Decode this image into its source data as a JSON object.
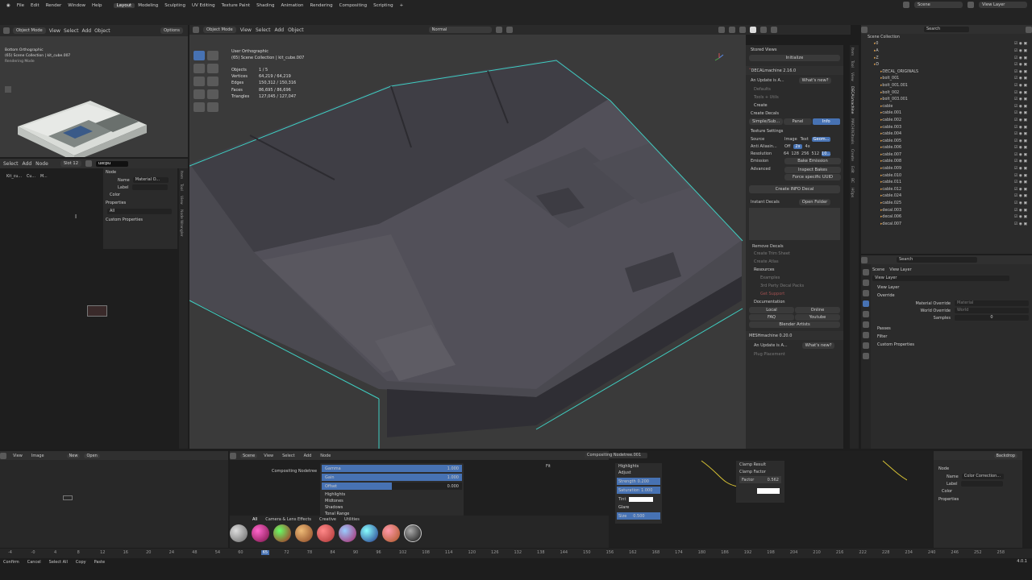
{
  "menu": {
    "items": [
      "File",
      "Edit",
      "Render",
      "Window",
      "Help"
    ],
    "workspaces": [
      "Layout",
      "Modeling",
      "Sculpting",
      "UV Editing",
      "Texture Paint",
      "Shading",
      "Animation",
      "Rendering",
      "Compositing",
      "Scripting"
    ],
    "active_workspace": "Layout",
    "scene": "Scene",
    "view_layer": "View Layer"
  },
  "left_tool_header": {
    "mode": "Object Mode",
    "items": [
      "View",
      "Select",
      "Add",
      "Object"
    ],
    "options": "Options"
  },
  "viewport_header": {
    "mode": "Object Mode",
    "items": [
      "View",
      "Select",
      "Add",
      "Object"
    ],
    "transform": "Normal",
    "options": "Options"
  },
  "mini_view": {
    "title": "Bottom Orthographic",
    "collection": "(65) Scene Collection | kit_cube.007",
    "label": "Rendering Mode"
  },
  "viewport": {
    "view_name": "User Orthographic",
    "collection": "(65) Scene Collection | kit_cube.007",
    "stats": [
      {
        "label": "Objects",
        "value": "1 / 5"
      },
      {
        "label": "Vertices",
        "value": "64,219 / 64,219"
      },
      {
        "label": "Edges",
        "value": "150,312 / 150,316"
      },
      {
        "label": "Faces",
        "value": "86,695 / 86,696"
      },
      {
        "label": "Triangles",
        "value": "127,045 / 127,047"
      }
    ]
  },
  "node_header": {
    "items": [
      "Select",
      "Add",
      "Node"
    ],
    "slot": "Slot 12",
    "material": "uxcpu"
  },
  "node_sidebar": {
    "node_label": "Node",
    "name_label": "Name",
    "name_value": "Material O...",
    "label_label": "Label",
    "color_label": "Color",
    "properties_label": "Properties",
    "all_label": "All",
    "custom_props": "Custom Properties"
  },
  "node_breadcrumb": [
    "Kit_cu...",
    "Cu...",
    "M..."
  ],
  "decal_panel": {
    "stored_views": "Stored Views",
    "initialize": "Initialize",
    "title": "DECALmachine 2.16.0",
    "update": "An Update is A...",
    "whats_new": "What's new?",
    "defaults": "Defaults",
    "tools": "Tools + Utils",
    "create": "Create",
    "create_decals": "Create Decals",
    "tabs": [
      "Simple/Sub...",
      "Panel",
      "Info"
    ],
    "active_tab": "Info",
    "texture_settings": "Texture Settings",
    "source_label": "Source",
    "source_options": [
      "Image",
      "Text",
      "Geom..."
    ],
    "anti_alias_label": "Anti Aliasin...",
    "anti_alias_options": [
      "Off",
      "2x",
      "4x"
    ],
    "resolution_label": "Resolution",
    "resolution_options": [
      "64",
      "128",
      "256",
      "512",
      "10..."
    ],
    "emission_label": "Emission",
    "bake_emission": "Bake Emission",
    "advanced_label": "Advanced",
    "inspect_bakes": "Inspect Bakes",
    "force_uuid": "Force specific UUID",
    "create_info": "Create INFO Decal",
    "instant_decals": "Instant Decals",
    "open_folder": "Open Folder",
    "remove_decals": "Remove Decals",
    "create_trim": "Create Trim Sheet",
    "create_atlas": "Create Atlas",
    "resources": "Resources",
    "examples": "Examples",
    "third_party": "3rd Party Decal Packs",
    "get_support": "Get Support",
    "documentation": "Documentation",
    "doc_buttons": [
      "Local",
      "Online",
      "FAQ",
      "Youtube"
    ],
    "blender_artists": "Blender Artists",
    "mesh_title": "MESHmachine 0.20.0",
    "mesh_update": "An Update is A...",
    "mesh_whats_new": "What's new?",
    "plug_placement": "Plug Placement"
  },
  "side_tabs": [
    "Item",
    "Tool",
    "View",
    "DECALmachine",
    "MACHIN3tools",
    "Create",
    "Edit",
    "BC",
    "HOps",
    "Kit Ops",
    "Node Wrangler",
    "Quick Tools",
    "Animation",
    "Grease Pencil"
  ],
  "outliner": {
    "title": "Scene Collection",
    "search_placeholder": "Search",
    "rows": [
      {
        "name": "0",
        "indent": 1
      },
      {
        "name": "A",
        "indent": 1
      },
      {
        "name": "Z",
        "indent": 1
      },
      {
        "name": "D",
        "indent": 1
      },
      {
        "name": "DECAL_ORIGINALS",
        "indent": 2
      },
      {
        "name": "bolt_001",
        "indent": 2
      },
      {
        "name": "bolt_001.001",
        "indent": 2
      },
      {
        "name": "bolt_002",
        "indent": 2
      },
      {
        "name": "bolt_003.001",
        "indent": 2
      },
      {
        "name": "cable",
        "indent": 2
      },
      {
        "name": "cable.001",
        "indent": 2
      },
      {
        "name": "cable.002",
        "indent": 2
      },
      {
        "name": "cable.003",
        "indent": 2
      },
      {
        "name": "cable.004",
        "indent": 2
      },
      {
        "name": "cable.005",
        "indent": 2
      },
      {
        "name": "cable.006",
        "indent": 2
      },
      {
        "name": "cable.007",
        "indent": 2
      },
      {
        "name": "cable.008",
        "indent": 2
      },
      {
        "name": "cable.009",
        "indent": 2
      },
      {
        "name": "cable.010",
        "indent": 2
      },
      {
        "name": "cable.011",
        "indent": 2
      },
      {
        "name": "cable.012",
        "indent": 2
      },
      {
        "name": "cable.024",
        "indent": 2
      },
      {
        "name": "cable.025",
        "indent": 2
      },
      {
        "name": "decal.003",
        "indent": 2
      },
      {
        "name": "decal.006",
        "indent": 2
      },
      {
        "name": "decal.007",
        "indent": 2
      }
    ]
  },
  "properties": {
    "search_placeholder": "Search",
    "breadcrumb_scene": "Scene",
    "breadcrumb_layer": "View Layer",
    "view_layer_name": "View Layer",
    "sections": {
      "view_layer": "View Layer",
      "override": "Override",
      "material_override": "Material Override",
      "material_placeholder": "Material",
      "world_override": "World Override",
      "world_placeholder": "World",
      "samples_label": "Samples",
      "samples_value": "0",
      "passes": "Passes",
      "filter": "Filter",
      "custom_properties": "Custom Properties"
    }
  },
  "image_editor": {
    "items": [
      "View",
      "Image"
    ],
    "new": "New",
    "open": "Open"
  },
  "compositor": {
    "scene": "Scene",
    "items": [
      "View",
      "Select",
      "Add",
      "Node"
    ],
    "nodetree": "Compositing Nodetree.001",
    "breadcrumb": "Compositing Nodetree",
    "gamma_label": "Gamma",
    "gamma_value": "1.000",
    "gain_label": "Gain",
    "gain_value": "1.000",
    "offset_label": "Offset",
    "offset_value": "0.000",
    "sections": [
      "Highlights",
      "Midtones",
      "Shadows",
      "Tonal Range"
    ],
    "fit": "Fit",
    "glare_items": [
      "Highlights",
      "Adjust"
    ],
    "strength_label": "Strength",
    "strength_value": "0.200",
    "saturation_label": "Saturation",
    "saturation_value": "1.000",
    "tint_label": "Tint",
    "glare_label": "Glare",
    "size_label": "Size",
    "size_value": "0.500",
    "clamp_result": "Clamp Result",
    "clamp_factor": "Clamp Factor",
    "factor_label": "Factor",
    "factor_value": "0.562",
    "backdrop": "Backdrop",
    "node_label": "Node",
    "name_label": "Name",
    "name_value": "Color Correction...",
    "label_label": "Label",
    "color_label": "Color",
    "properties_label": "Properties"
  },
  "asset_bar": {
    "tabs": [
      "All",
      "Camera & Lens Effects",
      "Creative",
      "Utilities"
    ]
  },
  "timeline": {
    "ticks": [
      "-4",
      "-0",
      "4",
      "8",
      "12",
      "16",
      "20",
      "24",
      "48",
      "54",
      "60",
      "65",
      "72",
      "78",
      "84",
      "90",
      "96",
      "102",
      "108",
      "114",
      "120",
      "126",
      "132",
      "138",
      "144",
      "150",
      "156",
      "162",
      "168",
      "174",
      "180",
      "186",
      "192",
      "198",
      "204",
      "210",
      "216",
      "222",
      "228",
      "234",
      "240",
      "246",
      "252",
      "258"
    ],
    "current_frame": "65"
  },
  "statusbar": {
    "items": [
      "Confirm",
      "Cancel",
      "Select All",
      "Copy",
      "Paste"
    ],
    "version": "4.0.1"
  },
  "colors": {
    "accent": "#4772b3",
    "selection_outline": "#3fcfc2",
    "timeline_frame": "#4772b3"
  }
}
